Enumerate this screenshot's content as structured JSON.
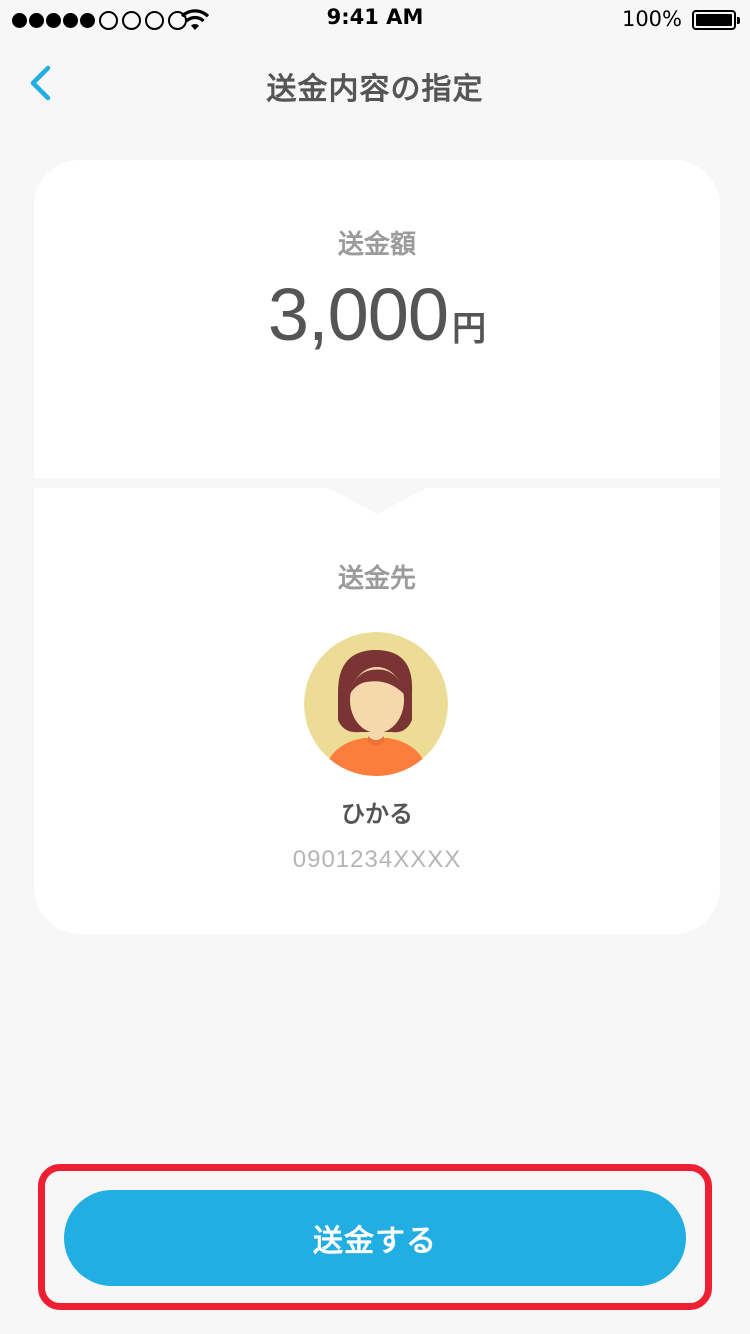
{
  "status_bar": {
    "time": "9:41 AM",
    "battery": "100%",
    "signal_filled": 5,
    "signal_empty": 4
  },
  "nav": {
    "back_icon": "chevron-left-icon",
    "title": "送金内容の指定"
  },
  "amount": {
    "label": "送金額",
    "value": "3,000",
    "unit": "円"
  },
  "recipient": {
    "label": "送金先",
    "name": "ひかる",
    "phone": "0901234XXXX",
    "avatar_icon": "person-avatar-icon"
  },
  "action": {
    "send_label": "送金する"
  },
  "colors": {
    "accent": "#22aee3",
    "highlight": "#ee1f32",
    "background": "#f7f7f7"
  }
}
